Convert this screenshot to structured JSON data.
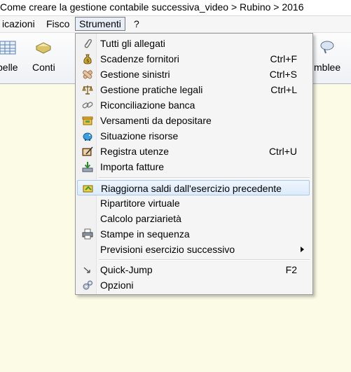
{
  "window": {
    "title": " Come creare la gestione contabile successiva_video > Rubino > 2016"
  },
  "menubar": {
    "items": [
      {
        "label": "icazioni"
      },
      {
        "label": "Fisco"
      },
      {
        "label": "Strumenti"
      },
      {
        "label": "?"
      }
    ]
  },
  "toolbar": {
    "items": [
      {
        "label": "pelle"
      },
      {
        "label": "Conti"
      },
      {
        "label": "mblee"
      }
    ]
  },
  "dropdown": {
    "items": [
      {
        "label": "Tutti gli allegati",
        "shortcut": ""
      },
      {
        "label": "Scadenze fornitori",
        "shortcut": "Ctrl+F"
      },
      {
        "label": "Gestione sinistri",
        "shortcut": "Ctrl+S"
      },
      {
        "label": "Gestione pratiche legali",
        "shortcut": "Ctrl+L"
      },
      {
        "label": "Riconciliazione banca",
        "shortcut": ""
      },
      {
        "label": "Versamenti da depositare",
        "shortcut": ""
      },
      {
        "label": "Situazione risorse",
        "shortcut": ""
      },
      {
        "label": "Registra utenze",
        "shortcut": "Ctrl+U"
      },
      {
        "label": "Importa fatture",
        "shortcut": ""
      },
      {
        "label": "Riaggiorna saldi dall'esercizio precedente",
        "shortcut": ""
      },
      {
        "label": "Ripartitore virtuale",
        "shortcut": ""
      },
      {
        "label": "Calcolo parziarietà",
        "shortcut": ""
      },
      {
        "label": "Stampe in sequenza",
        "shortcut": ""
      },
      {
        "label": "Previsioni esercizio successivo",
        "shortcut": ""
      },
      {
        "label": "Quick-Jump",
        "shortcut": "F2"
      },
      {
        "label": "Opzioni",
        "shortcut": ""
      }
    ]
  }
}
